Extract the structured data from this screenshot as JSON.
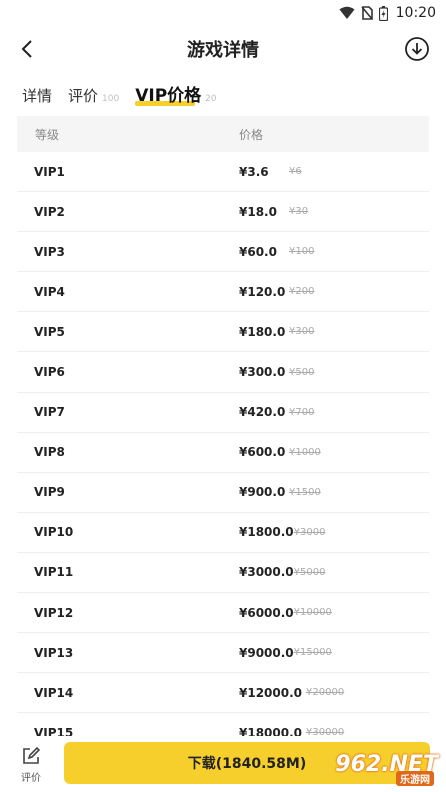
{
  "status": {
    "time": "10:20"
  },
  "header": {
    "title": "游戏详情"
  },
  "tabs": [
    {
      "label": "详情",
      "count": ""
    },
    {
      "label": "评价",
      "count": "100"
    },
    {
      "label": "VIP价格",
      "count": "20"
    }
  ],
  "table": {
    "headers": [
      "等级",
      "价格"
    ],
    "rows": [
      {
        "level": "VIP1",
        "price": "¥3.6",
        "original": "¥6"
      },
      {
        "level": "VIP2",
        "price": "¥18.0",
        "original": "¥30"
      },
      {
        "level": "VIP3",
        "price": "¥60.0",
        "original": "¥100"
      },
      {
        "level": "VIP4",
        "price": "¥120.0",
        "original": "¥200"
      },
      {
        "level": "VIP5",
        "price": "¥180.0",
        "original": "¥300"
      },
      {
        "level": "VIP6",
        "price": "¥300.0",
        "original": "¥500"
      },
      {
        "level": "VIP7",
        "price": "¥420.0",
        "original": "¥700"
      },
      {
        "level": "VIP8",
        "price": "¥600.0",
        "original": "¥1000"
      },
      {
        "level": "VIP9",
        "price": "¥900.0",
        "original": "¥1500"
      },
      {
        "level": "VIP10",
        "price": "¥1800.0",
        "original": "¥3000"
      },
      {
        "level": "VIP11",
        "price": "¥3000.0",
        "original": "¥5000"
      },
      {
        "level": "VIP12",
        "price": "¥6000.0",
        "original": "¥10000"
      },
      {
        "level": "VIP13",
        "price": "¥9000.0",
        "original": "¥15000"
      },
      {
        "level": "VIP14",
        "price": "¥12000.0",
        "original": "¥20000"
      },
      {
        "level": "VIP15",
        "price": "¥18000.0",
        "original": "¥30000"
      }
    ]
  },
  "bottom": {
    "review_label": "评价",
    "download_label": "下载(1840.58M)",
    "watermark": "962.NET",
    "watermark_sub": "乐游网"
  },
  "colors": {
    "accent": "#f7cf2c",
    "watermark": "#e0681a"
  },
  "icons": [
    "wifi-icon",
    "no-sim-icon",
    "battery-icon",
    "back-arrow-icon",
    "download-circle-icon",
    "edit-review-icon"
  ]
}
